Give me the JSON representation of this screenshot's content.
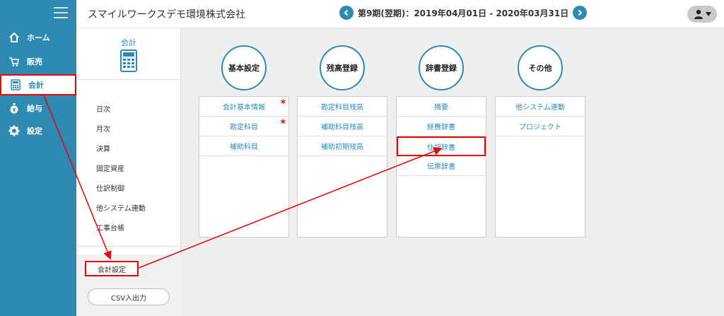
{
  "header": {
    "company": "スマイルワークスデモ環境株式会社",
    "period": "第9期(翌期)：2019年04月01日 - 2020年03月31日"
  },
  "sidebar": {
    "items": [
      {
        "label": "ホーム",
        "icon": "home-icon"
      },
      {
        "label": "販売",
        "icon": "cart-icon"
      },
      {
        "label": "会計",
        "icon": "calculator-icon"
      },
      {
        "label": "給与",
        "icon": "money-bag-icon"
      },
      {
        "label": "設定",
        "icon": "gear-icon"
      }
    ]
  },
  "subpanel": {
    "title": "会計",
    "items": [
      "日次",
      "月次",
      "決算",
      "固定資産",
      "仕訳制御",
      "他システム連動",
      "工事台帳"
    ],
    "settings": "会計設定",
    "csv": "CSV入出力"
  },
  "main": {
    "categories": [
      {
        "title": "基本設定",
        "items": [
          "会計基本情報",
          "勘定科目",
          "補助科目"
        ]
      },
      {
        "title": "残高登録",
        "items": [
          "勘定科目残高",
          "補助科目残高",
          "補助初期残高"
        ]
      },
      {
        "title": "辞書登録",
        "items": [
          "摘要",
          "経費辞書",
          "仕訳辞書",
          "伝票辞書"
        ]
      },
      {
        "title": "その他",
        "items": [
          "他システム連動",
          "プロジェクト"
        ]
      }
    ]
  },
  "colors": {
    "brand": "#2e8ab3",
    "highlight": "#ee0000",
    "required": "#ee0000"
  }
}
